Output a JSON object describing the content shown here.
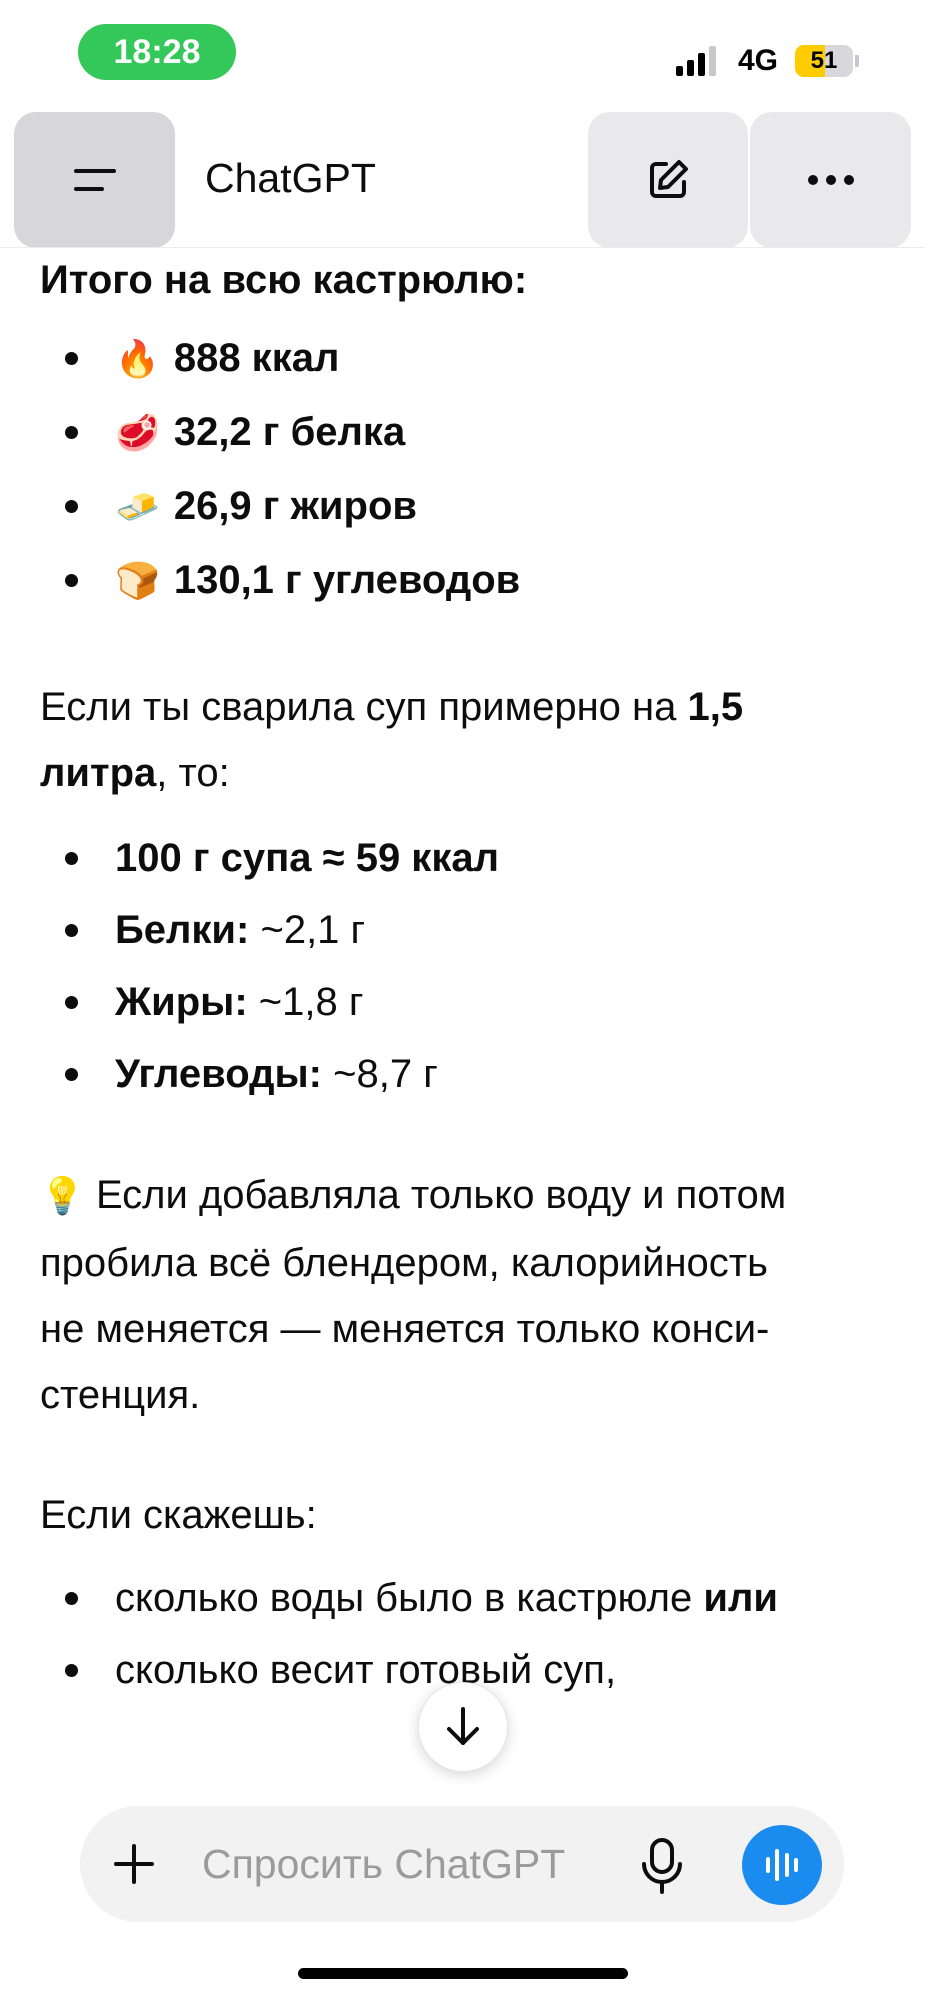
{
  "status_bar": {
    "time": "18:28",
    "network": "4G",
    "battery_percent": 51,
    "battery_label": "51"
  },
  "header": {
    "title": "ChatGPT"
  },
  "message": {
    "total_heading": "Итого на всю кастрюлю:",
    "totals": [
      {
        "icon": "fire-emoji",
        "glyph": "🔥",
        "text": "888 ккал"
      },
      {
        "icon": "meat-emoji",
        "glyph": "🥩",
        "text": "32,2 г белка"
      },
      {
        "icon": "butter-emoji",
        "glyph": "🧈",
        "text": "26,9 г жиров"
      },
      {
        "icon": "bread-emoji",
        "glyph": "🍞",
        "text": "130,1 г углеводов"
      }
    ],
    "soup_para": {
      "prefix": "Если ты сварила суп примерно на ",
      "bold": "1,5",
      "bold2": "литра",
      "suffix": ", то:"
    },
    "per100": [
      {
        "label": "100 г супа ≈ 59 ккал",
        "value": ""
      },
      {
        "label": "Белки:",
        "value": " ~2,1 г"
      },
      {
        "label": "Жиры:",
        "value": " ~1,8 г"
      },
      {
        "label": "Углеводы:",
        "value": " ~8,7 г"
      }
    ],
    "tip": {
      "icon": "lightbulb-emoji",
      "glyph": "💡",
      "line1": " Если добавляла только воду и потом",
      "line2": "пробила всё блендером, калорийность",
      "line3": "не меняется — меняется только конси-",
      "line4": "стенция."
    },
    "ask_para": "Если скажешь:",
    "ask_items": [
      {
        "text": "сколько воды было в кастрюле ",
        "bold": "или"
      },
      {
        "text": "сколько весит готовый суп,",
        "bold": ""
      }
    ]
  },
  "composer": {
    "placeholder": "Спросить ChatGPT"
  }
}
